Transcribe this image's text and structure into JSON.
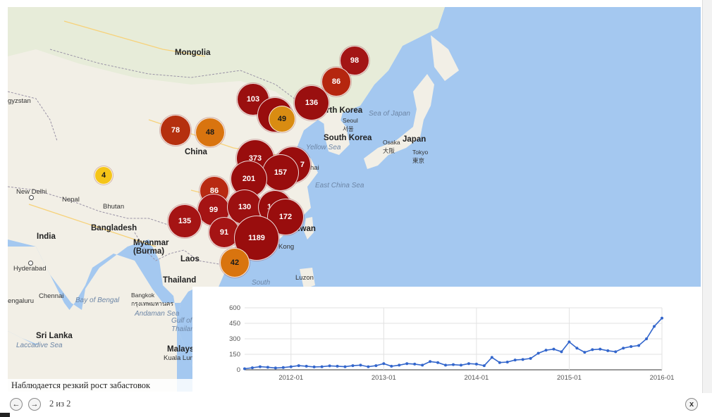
{
  "map": {
    "countries": [
      {
        "id": "mongolia",
        "label": "Mongolia"
      },
      {
        "id": "china",
        "label": "China"
      },
      {
        "id": "north-korea",
        "label": "orth Korea"
      },
      {
        "id": "south-korea",
        "label": "South Korea"
      },
      {
        "id": "japan",
        "label": "Japan"
      },
      {
        "id": "india",
        "label": "India"
      },
      {
        "id": "bangladesh",
        "label": "Bangladesh"
      },
      {
        "id": "myanmar",
        "label": "Myanmar\n(Burma)"
      },
      {
        "id": "laos",
        "label": "Laos"
      },
      {
        "id": "thailand",
        "label": "Thailand"
      },
      {
        "id": "sri-lanka",
        "label": "Sri Lanka"
      },
      {
        "id": "nepal",
        "label": "Nepal"
      },
      {
        "id": "bhutan",
        "label": "Bhutan"
      },
      {
        "id": "taiwan",
        "label": "aiwan"
      },
      {
        "id": "malaysia",
        "label": "Malays"
      },
      {
        "id": "kyrgyzstan",
        "label": "gyzstan"
      },
      {
        "id": "luzon",
        "label": "Luzon"
      }
    ],
    "cities": [
      {
        "id": "new-delhi",
        "label": "New Delhi"
      },
      {
        "id": "hyderabad",
        "label": "Hyderabad"
      },
      {
        "id": "chennai",
        "label": "Chennai"
      },
      {
        "id": "bengaluru",
        "label": "engaluru"
      },
      {
        "id": "bangkok",
        "label": "Bangkok\nกรุงเทพมหานคร"
      },
      {
        "id": "kuala-lumpur",
        "label": "Kuala Lum"
      },
      {
        "id": "seoul",
        "label": "Seoul\n서울"
      },
      {
        "id": "osaka",
        "label": "Osaka\n大阪"
      },
      {
        "id": "tokyo",
        "label": "Tokyo\n東京"
      },
      {
        "id": "hong-kong",
        "label": "Kong"
      },
      {
        "id": "shanghai",
        "label": "hai"
      }
    ],
    "seas": [
      {
        "id": "sea-of-japan",
        "label": "Sea of Japan"
      },
      {
        "id": "yellow-sea",
        "label": "Yellow Sea"
      },
      {
        "id": "east-china-sea",
        "label": "East China Sea"
      },
      {
        "id": "bay-of-bengal",
        "label": "Bay of Bengal"
      },
      {
        "id": "andaman-sea",
        "label": "Andaman Sea"
      },
      {
        "id": "gulf-of-thailand",
        "label": "Gulf of\nThailand"
      },
      {
        "id": "laccadive-sea",
        "label": "Laccadive Sea"
      },
      {
        "id": "south",
        "label": "South"
      }
    ],
    "markers": [
      {
        "count": "98",
        "color": "#a31515"
      },
      {
        "count": "86",
        "color": "#b5260f"
      },
      {
        "count": "103",
        "color": "#9a0f0f"
      },
      {
        "count": "136",
        "color": "#9a0f0f"
      },
      {
        "count": "49",
        "color": "#d98c12"
      },
      {
        "count": "78",
        "color": "#b5300f"
      },
      {
        "count": "48",
        "color": "#d9740f"
      },
      {
        "count": "4",
        "color": "#f5c518"
      },
      {
        "count": "373",
        "color": "#990d0d"
      },
      {
        "count": "7",
        "color": "#990d0d"
      },
      {
        "count": "157",
        "color": "#990d0d"
      },
      {
        "count": "201",
        "color": "#990d0d"
      },
      {
        "count": "86",
        "color": "#b82a12"
      },
      {
        "count": "99",
        "color": "#a51414"
      },
      {
        "count": "130",
        "color": "#9c1010"
      },
      {
        "count": "1",
        "color": "#990d0d"
      },
      {
        "count": "172",
        "color": "#990d0d"
      },
      {
        "count": "135",
        "color": "#a51414"
      },
      {
        "count": "91",
        "color": "#a51414"
      },
      {
        "count": "1189",
        "color": "#990d0d"
      },
      {
        "count": "42",
        "color": "#d9740f"
      }
    ],
    "colors": {
      "water": "#a4c8f0",
      "land": "#f2efe6",
      "land_north": "#e7ecd9",
      "border": "#9a93a6",
      "road": "#f7d27a"
    }
  },
  "chart_data": {
    "type": "line",
    "x_ticks": [
      "2012-01",
      "2013-01",
      "2014-01",
      "2015-01",
      "2016-01"
    ],
    "y_ticks": [
      "0",
      "150",
      "300",
      "450",
      "600"
    ],
    "ylim": [
      0,
      600
    ],
    "x": [
      "2011-07",
      "2011-08",
      "2011-09",
      "2011-10",
      "2011-11",
      "2011-12",
      "2012-01",
      "2012-02",
      "2012-03",
      "2012-04",
      "2012-05",
      "2012-06",
      "2012-07",
      "2012-08",
      "2012-09",
      "2012-10",
      "2012-11",
      "2012-12",
      "2013-01",
      "2013-02",
      "2013-03",
      "2013-04",
      "2013-05",
      "2013-06",
      "2013-07",
      "2013-08",
      "2013-09",
      "2013-10",
      "2013-11",
      "2013-12",
      "2014-01",
      "2014-02",
      "2014-03",
      "2014-04",
      "2014-05",
      "2014-06",
      "2014-07",
      "2014-08",
      "2014-09",
      "2014-10",
      "2014-11",
      "2014-12",
      "2015-01",
      "2015-02",
      "2015-03",
      "2015-04",
      "2015-05",
      "2015-06",
      "2015-07",
      "2015-08",
      "2015-09",
      "2015-10",
      "2015-11",
      "2015-12",
      "2016-01"
    ],
    "series": [
      {
        "color": "#3366cc",
        "values": [
          10,
          20,
          30,
          25,
          18,
          22,
          30,
          40,
          35,
          28,
          30,
          38,
          35,
          30,
          40,
          45,
          30,
          40,
          60,
          35,
          45,
          60,
          55,
          45,
          80,
          70,
          45,
          50,
          45,
          60,
          55,
          40,
          120,
          70,
          75,
          95,
          100,
          110,
          160,
          190,
          200,
          175,
          270,
          210,
          170,
          195,
          200,
          185,
          175,
          210,
          225,
          235,
          300,
          420,
          500
        ]
      }
    ]
  },
  "caption": "Наблюдается резкий рост забастовок",
  "pager": {
    "counter": "2 из 2",
    "prev": "←",
    "next": "→",
    "close": "x"
  }
}
